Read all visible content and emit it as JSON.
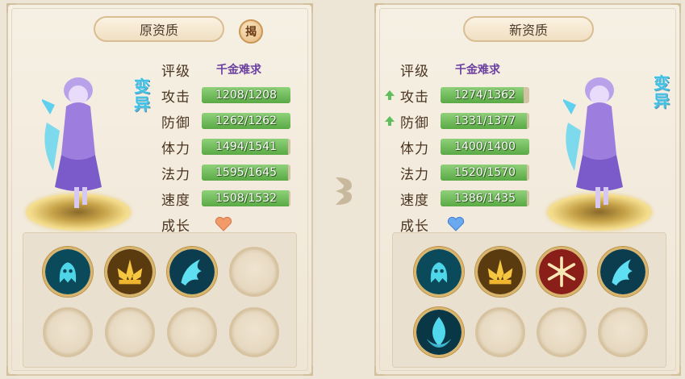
{
  "left_panel": {
    "title": "原资质",
    "reveal_button": "揭",
    "mutation_label": "变异",
    "rating_label": "评级",
    "rating_value": "千金难求",
    "stats": [
      {
        "label": "攻击",
        "value": "1208/1208",
        "fill": 1.0
      },
      {
        "label": "防御",
        "value": "1262/1262",
        "fill": 1.0
      },
      {
        "label": "体力",
        "value": "1494/1541",
        "fill": 0.97
      },
      {
        "label": "法力",
        "value": "1595/1645",
        "fill": 0.97
      },
      {
        "label": "速度",
        "value": "1508/1532",
        "fill": 0.98
      }
    ],
    "growth_label": "成长",
    "growth_icon": "orange-heart-icon",
    "skills": [
      "ghost-spirit-skill-icon",
      "golden-lotus-skill-icon",
      "ice-wing-skill-icon",
      "empty",
      "empty",
      "empty",
      "empty",
      "empty"
    ]
  },
  "right_panel": {
    "title": "新资质",
    "mutation_label": "变异",
    "rating_label": "评级",
    "rating_value": "千金难求",
    "stats": [
      {
        "label": "攻击",
        "value": "1274/1362",
        "fill": 0.94,
        "up": true
      },
      {
        "label": "防御",
        "value": "1331/1377",
        "fill": 0.97,
        "up": true
      },
      {
        "label": "体力",
        "value": "1400/1400",
        "fill": 1.0,
        "up": false
      },
      {
        "label": "法力",
        "value": "1520/1570",
        "fill": 0.97,
        "up": false
      },
      {
        "label": "速度",
        "value": "1386/1435",
        "fill": 0.97,
        "up": false
      }
    ],
    "growth_label": "成长",
    "growth_icon": "blue-heart-icon",
    "skills": [
      "ghost-spirit-skill-icon",
      "golden-lotus-skill-icon",
      "snowflake-skill-icon",
      "ice-wing-skill-icon",
      "cyan-flame-skill-icon",
      "empty",
      "empty",
      "empty"
    ]
  },
  "colors": {
    "bar_fill": "#6dbb55",
    "bar_track": "#d3c3a5",
    "mutation": "#3ec1e6",
    "rating": "#6b3fa0",
    "arrow_up": "#5fbf5f"
  }
}
